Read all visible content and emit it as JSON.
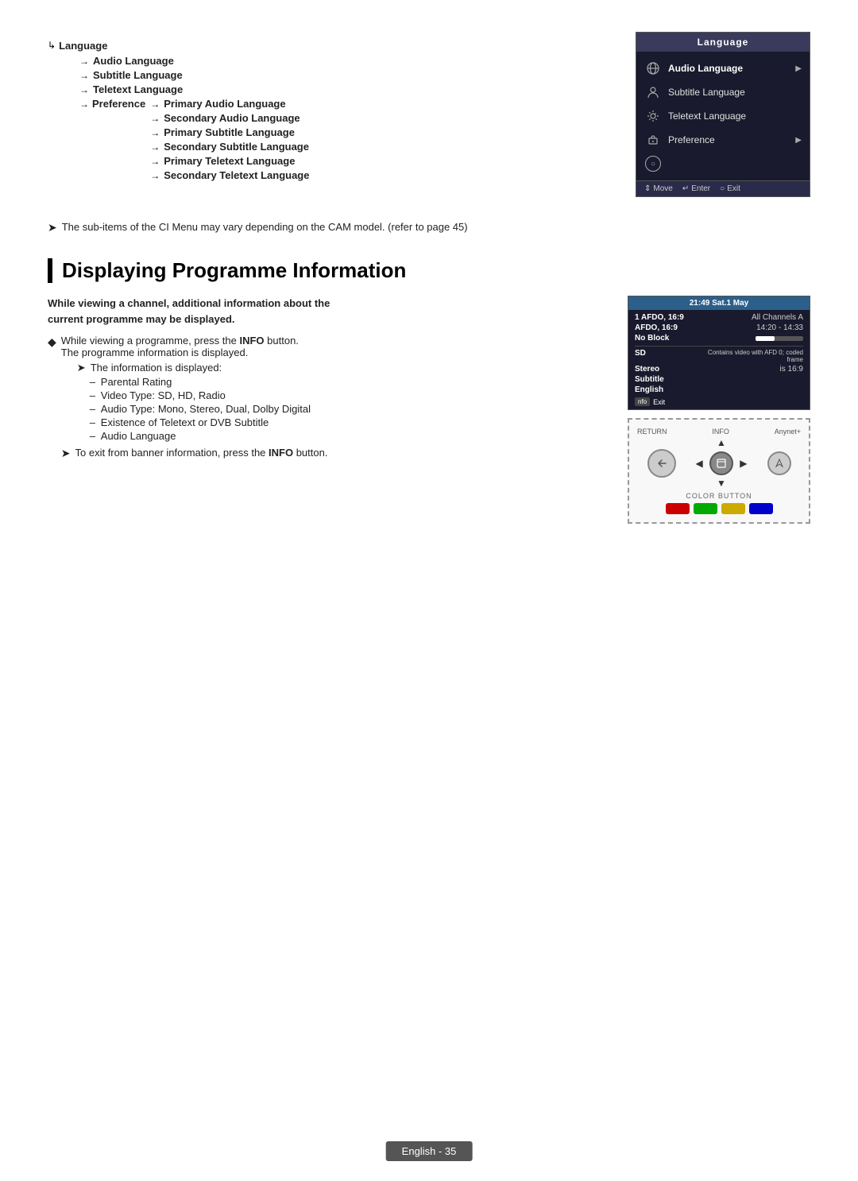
{
  "page": {
    "footer_label": "English - 35"
  },
  "top_section": {
    "tree": {
      "root": "Language",
      "items": [
        {
          "label": "Audio Language"
        },
        {
          "label": "Subtitle Language"
        },
        {
          "label": "Teletext Language"
        },
        {
          "label": "Preference",
          "sub_items": [
            {
              "label": "Primary Audio Language"
            },
            {
              "label": "Secondary Audio Language"
            },
            {
              "label": "Primary Subtitle Language"
            },
            {
              "label": "Secondary Subtitle Language"
            },
            {
              "label": "Primary Teletext Language"
            },
            {
              "label": "Secondary Teletext Language"
            }
          ]
        }
      ]
    },
    "tv_menu": {
      "title": "Language",
      "rows": [
        {
          "icon": "globe",
          "label": "Audio Language",
          "has_arrow": true
        },
        {
          "icon": "person",
          "label": "Subtitle Language",
          "has_arrow": false
        },
        {
          "icon": "settings",
          "label": "Teletext Language",
          "has_arrow": false
        },
        {
          "icon": "gear",
          "label": "Preference",
          "has_arrow": true
        },
        {
          "icon": "lock",
          "label": "",
          "has_arrow": false
        }
      ],
      "footer": {
        "move": "Move",
        "enter": "Enter",
        "exit": "Exit"
      }
    },
    "note": "The sub-items of the CI Menu may vary depending on the CAM model. (refer to page 45)"
  },
  "programme_section": {
    "title": "Displaying Programme Information",
    "intro_line1": "While viewing a channel, additional information about the",
    "intro_line2": "current programme may be displayed.",
    "bullet1": {
      "text_normal": "While viewing a programme, press the ",
      "text_bold": "INFO",
      "text_after": " button.",
      "sub_text": "The programme information is displayed."
    },
    "sub_list_header": "The information is displayed:",
    "sub_list_items": [
      "Parental Rating",
      "Video Type: SD, HD, Radio",
      "Audio Type: Mono, Stereo, Dual, Dolby Digital",
      "Existence of Teletext or DVB Subtitle",
      "Audio Language"
    ],
    "note2_normal": "To exit from banner information, press the ",
    "note2_bold": "INFO",
    "note2_after": " button.",
    "info_panel": {
      "header": "21:49 Sat.1 May",
      "channel": "1 AFDO, 16:9",
      "all_channels": "All Channels A",
      "afdo": "AFDO, 16:9",
      "time": "14:20 - 14:33",
      "no_block": "No Block",
      "sd": "SD",
      "sd_desc": "Contains video with AFD 0; coded frame",
      "stereo": "Stereo",
      "is_169": "is 16:9",
      "subtitle": "Subtitle",
      "english": "English",
      "exit_label": "Exit"
    },
    "remote": {
      "return_label": "RETURN",
      "info_label": "INFO",
      "anynet_label": "Anynet+",
      "color_label": "COLOR BUTTON"
    }
  }
}
